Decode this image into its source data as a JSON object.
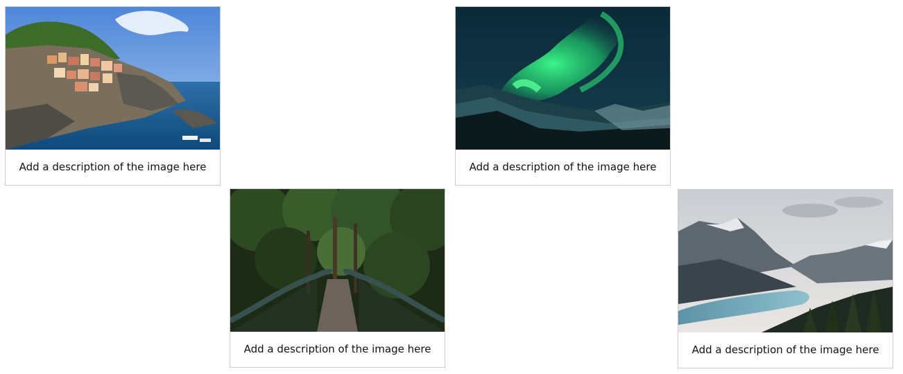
{
  "gallery": {
    "items": [
      {
        "icon": "coastal-village-image",
        "description": "Add a description of the image here"
      },
      {
        "icon": "northern-lights-image",
        "description": "Add a description of the image here"
      },
      {
        "icon": "forest-bridge-image",
        "description": "Add a description of the image here"
      },
      {
        "icon": "mountain-lake-image",
        "description": "Add a description of the image here"
      }
    ]
  }
}
